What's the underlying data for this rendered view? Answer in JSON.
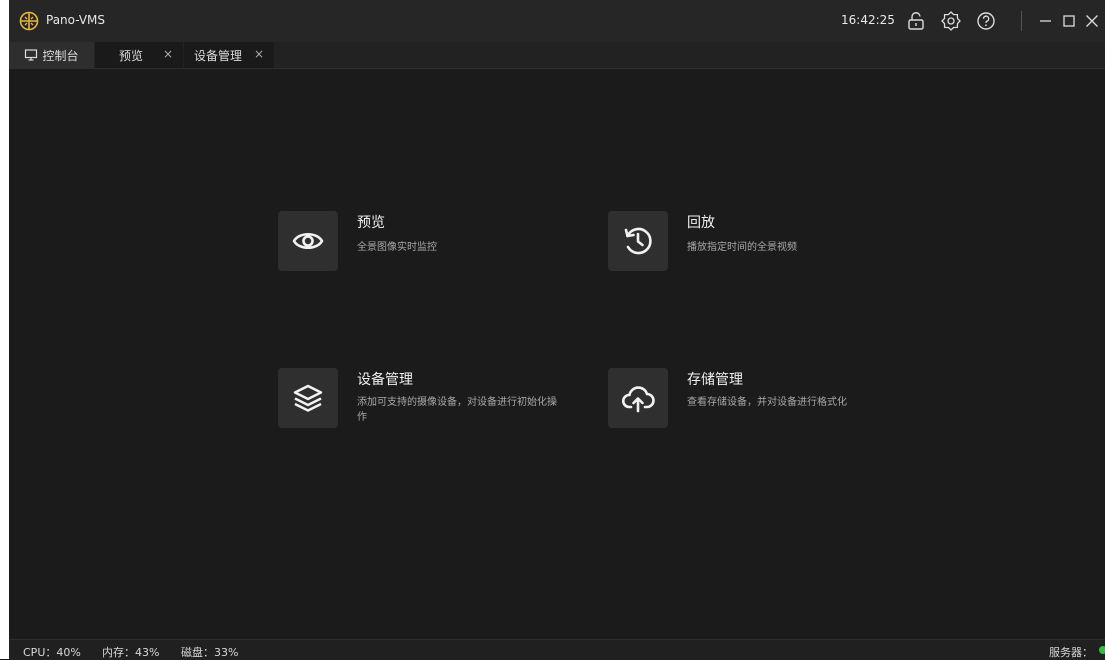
{
  "app": {
    "title": "Pano-VMS",
    "clock": "16:42:25"
  },
  "tabs": [
    {
      "label": "控制台",
      "icon": "monitor-icon"
    },
    {
      "label": "预览",
      "close": "×"
    },
    {
      "label": "设备管理",
      "close": "×"
    }
  ],
  "cards": [
    {
      "title": "预览",
      "desc": "全景图像实时监控",
      "icon": "eye-icon"
    },
    {
      "title": "回放",
      "desc": "播放指定时间的全景视频",
      "icon": "history-icon"
    },
    {
      "title": "设备管理",
      "desc": "添加可支持的摄像设备，对设备进行初始化操作",
      "icon": "layers-icon"
    },
    {
      "title": "存储管理",
      "desc": "查看存储设备，并对设备进行格式化",
      "icon": "cloud-upload-icon"
    }
  ],
  "status": {
    "cpu": "CPU：40%",
    "memory": "内存：43%",
    "disk": "磁盘：33%",
    "server": "服务器："
  },
  "colors": {
    "background": "#1b1b1b",
    "titlebar": "#262626",
    "card_icon_bg": "#2f2f2f",
    "server_ok": "#2fbf3f"
  }
}
